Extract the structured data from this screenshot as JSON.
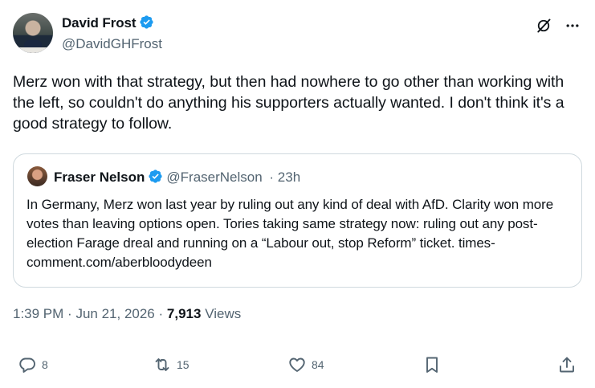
{
  "author": {
    "name": "David Frost",
    "handle": "@DavidGHFrost"
  },
  "tweet": {
    "text": "Merz won with that strategy, but then had nowhere to go other than working with the left, so couldn't do anything his supporters actually wanted. I don't think it's a good strategy to follow."
  },
  "quote": {
    "name": "Fraser Nelson",
    "handle": "@FraserNelson",
    "time": "· 23h",
    "text": "In Germany, Merz won last year by ruling out any kind of deal with AfD. Clarity won more votes than leaving options open. Tories taking same strategy now: ruling out any post-election Farage dreal and running on a “Labour out, stop Reform” ticket. times-comment.com/aberbloodydeen"
  },
  "meta": {
    "time": "1:39 PM",
    "sep1": "·",
    "date": "Jun 21, 2026",
    "sep2": "·",
    "views": "7,913",
    "views_label": "Views"
  },
  "actions": {
    "replies": "8",
    "reposts": "15",
    "likes": "84"
  },
  "colors": {
    "verified": "#1d9bf0",
    "secondary_text": "#536471",
    "border": "#cfd9de"
  },
  "icons": [
    "verified-badge-icon",
    "grok-icon",
    "more-icon",
    "reply-icon",
    "repost-icon",
    "like-icon",
    "bookmark-icon",
    "share-icon"
  ]
}
